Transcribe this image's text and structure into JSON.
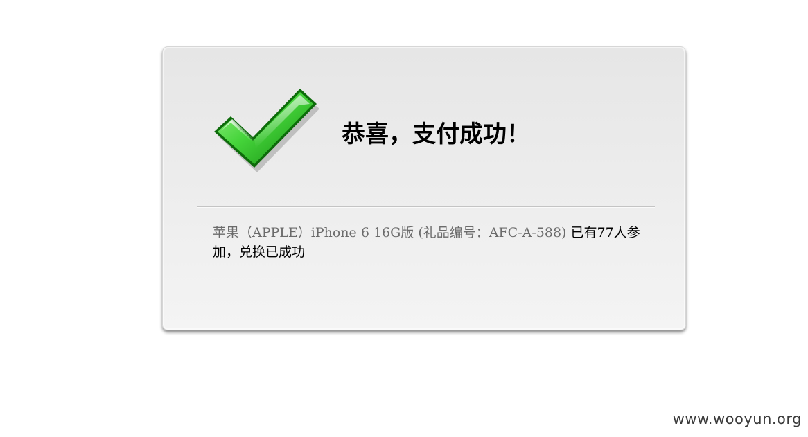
{
  "card": {
    "icon": "green-checkmark-icon",
    "title": "恭喜，支付成功！",
    "product_text": "苹果（APPLE）iPhone 6 16G版 (礼品编号：AFC-A-588)",
    "status_text": " 已有77人参加，兑换已成功"
  },
  "watermark": "www.wooyun.org",
  "colors": {
    "check_green": "#2fb52a",
    "product_text": "#6b6b6b",
    "title_text": "#000000"
  }
}
